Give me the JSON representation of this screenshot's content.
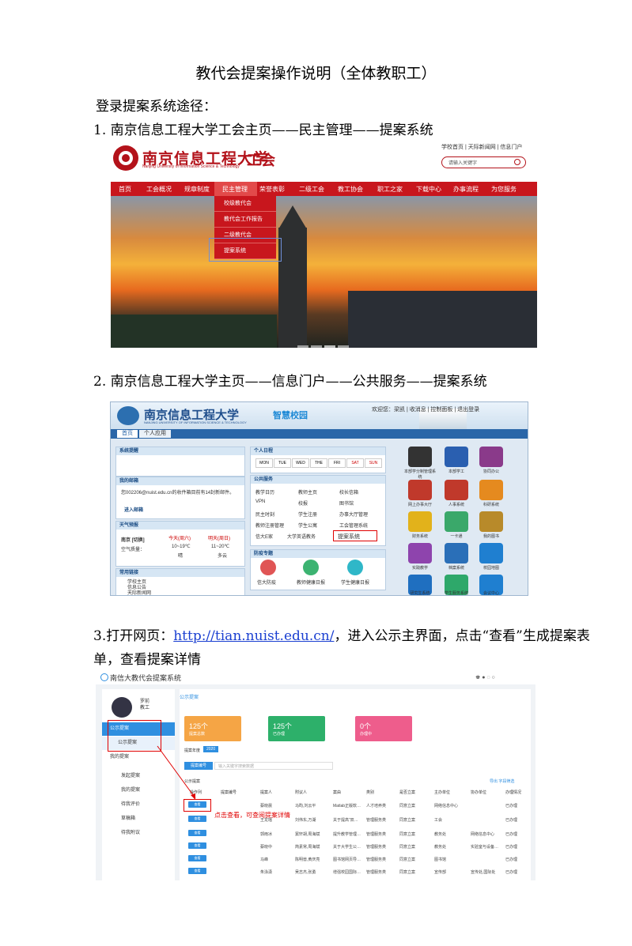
{
  "title": "教代会提案操作说明（全体教职工）",
  "lead": "登录提案系统途径：",
  "step1": "1. 南京信息工程大学工会主页——民主管理——提案系统",
  "step2": "2.  南京信息工程大学主页——信息门户——公共服务——提案系统",
  "step3": {
    "prefix": "3.打开网页：",
    "link": "http://tian.nuist.edu.cn/",
    "suffix": "，进入公示主界面，点击“查看”生成提案表",
    "line2": "单，查看提案详情"
  },
  "shot1": {
    "uni_name": "南京信息工程大学",
    "uni_en": "Nanjing University of Information Science & Technology",
    "union": "工会",
    "top_links": "学校首页 | 天际新闻网 | 信息门户",
    "search_placeholder": "请输入关键字",
    "nav": [
      "首页",
      "工会概况",
      "规章制度",
      "民主管理",
      "荣誉表彰",
      "二级工会",
      "教工协会",
      "职工之家",
      "下载中心",
      "办事流程",
      "为您服务"
    ],
    "dropdown": [
      "校级教代会",
      "教代会工作报告",
      "二级教代会",
      "提案系统"
    ]
  },
  "shot2": {
    "uni_name": "南京信息工程大学",
    "uni_en": "NANJING UNIVERSITY OF INFORMATION SCIENCE & TECHNOLOGY",
    "smart": "智慧校园",
    "welcome": "欢迎您：梁凯  |  收消息  |  控制面板  |  退出登录",
    "tabs": [
      "首页",
      "个人应用"
    ],
    "panels": {
      "system": "系统提醒",
      "mail": "我的邮箱",
      "mail_text": "您002206@nuist.edu.cn的收件箱目前有14封新邮件。",
      "mail_link": "进入邮箱",
      "weather": "天气预报",
      "city": "南京 [切换]",
      "today": "今天(周六)",
      "tomorrow": "明天(周日)",
      "temp1": "10~19℃",
      "temp2": "11~20℃",
      "air": "空气质量：",
      "sky1": "晴",
      "sky2": "多云",
      "links": "常用链接",
      "link_items": [
        "学校主页",
        "信息公告",
        "天际新闻网"
      ],
      "personal": "个人日程",
      "days": [
        "MON",
        "TUE",
        "WED",
        "THE",
        "FRI",
        "SAT",
        "SUN"
      ],
      "public": "公共服务",
      "services": [
        "教学日历",
        "教师主页",
        "校长信箱",
        "VPN",
        "校报",
        "图书馆",
        "民主时刻",
        "学生注册",
        "办事大厅管理",
        "教师注册管理",
        "学生公寓",
        "工会管理系统",
        "信大E家",
        "大学英语教务",
        "提案系统"
      ],
      "epidemic": "防疫专题",
      "ep_items": [
        "信大防疫",
        "教师健康日报",
        "学生健康日报"
      ]
    },
    "apps": [
      "本部学分制管理系统",
      "本部学工",
      "协同办公",
      "网上办事大厅",
      "人事系统",
      "科研系统",
      "财务系统",
      "一卡通",
      "我的图书",
      "实践教学",
      "档案系统",
      "校园地图",
      "研究生系统",
      "学生服务系统",
      "会议中心"
    ]
  },
  "shot3": {
    "system_title": "南信大教代会提案系统",
    "user": "罗前",
    "role": "教工",
    "side_items": [
      "公示提案",
      "公示提案",
      "我的提案",
      "发起提案",
      "我的提案",
      "待我评价",
      "草稿箱",
      "待我附议"
    ],
    "tab": "公示提案",
    "cards": [
      {
        "num": "125个",
        "label": "提案总数",
        "color": "#f5a545"
      },
      {
        "num": "125个",
        "label": "已办理",
        "color": "#2db06a"
      },
      {
        "num": "0个",
        "label": "办理中",
        "color": "#ee5d8c"
      }
    ],
    "year_label": "提案年度",
    "year": "2020",
    "search_btn": "提案编号",
    "search_placeholder": "输入关键字搜索数据",
    "table_caption": "公示提案",
    "export": "导出   字段筛选",
    "headers": [
      "操作列",
      "提案编号",
      "提案人",
      "附议人",
      "案由",
      "类别",
      "是否立案",
      "主办单位",
      "协办单位",
      "办理情况"
    ],
    "view_label": "查看",
    "rows": [
      [
        "",
        "蔡晓晨",
        "马昀,刘云平",
        "Matlab正版软…",
        "人才培养类",
        "同意立案",
        "网络信息中心",
        "",
        "已办理"
      ],
      [
        "",
        "王龙瑶",
        "刘伟东,万湖",
        "关于提高“双…",
        "管理服务类",
        "同意立案",
        "工会",
        "",
        "已办理"
      ],
      [
        "",
        "郭雨冰",
        "窦轩胡,周海斌",
        "提升教学管理…",
        "管理服务类",
        "同意立案",
        "教务处",
        "网络信息中心",
        "已办理"
      ],
      [
        "",
        "蔡晓中",
        "简素常,周海斌",
        "关于大学生公…",
        "管理服务类",
        "同意立案",
        "教务处",
        "实验室与设备…",
        "已办理"
      ],
      [
        "",
        "马峰",
        "陈明兽,黄庆亮",
        "图书馆网页导…",
        "管理服务类",
        "同意立案",
        "图书馆",
        "",
        "已办理"
      ],
      [
        "",
        "朱泳潇",
        "吴志杰,张勇",
        "增强校园国际…",
        "管理服务类",
        "同意立案",
        "宣传部",
        "宣传处,国际处",
        "已办理"
      ]
    ],
    "annotation": "点击查看，可查阅提案详情"
  }
}
